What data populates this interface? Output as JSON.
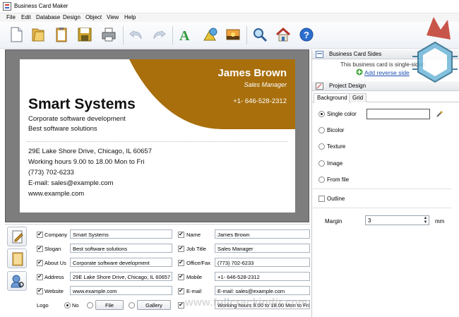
{
  "window": {
    "title": "Business Card Maker"
  },
  "menu": [
    "File",
    "Edit",
    "Database",
    "Design",
    "Object",
    "View",
    "Help"
  ],
  "toolbar": {
    "icons": [
      "new-document-icon",
      "open-folder-icon",
      "clipboard-icon",
      "save-icon",
      "print-icon",
      "undo-icon",
      "redo-icon",
      "text-icon",
      "shapes-icon",
      "image-icon",
      "zoom-icon",
      "home-icon",
      "help-icon"
    ]
  },
  "card": {
    "company": "Smart Systems",
    "slogan_line1": "Corporate software development",
    "slogan_line2": "Best software solutions",
    "name": "James Brown",
    "job_title": "Sales Manager",
    "phone": "+1- 646-528-2312",
    "address": "29E Lake Shore Drive, Chicago, IL 60657",
    "hours": "Working hours 9.00 to 18.00 Mon to Fri",
    "office_fax": "(773) 702-6233",
    "email": "E-mail: sales@example.com",
    "website": "www.example.com",
    "accent_color": "#A86F0C"
  },
  "panel": {
    "sides_header": "Business Card Sides",
    "sides_note": "This business card is single-sided.",
    "add_reverse": "Add reverse side",
    "project_header": "Project Design",
    "tabs": [
      "Background",
      "Grid"
    ],
    "bg_options": [
      "Single color",
      "Bicolor",
      "Texture",
      "Image",
      "From file"
    ],
    "selected_option": "Single color",
    "outline_label": "Outline",
    "margin_label": "Margin",
    "margin_value": "3",
    "margin_unit": "mm"
  },
  "form": {
    "left": [
      {
        "label": "Company",
        "value": "Smart Systems"
      },
      {
        "label": "Slogan",
        "value": "Best software solutions"
      },
      {
        "label": "About Us",
        "value": "Corporate software development"
      },
      {
        "label": "Address",
        "value": "29E Lake Shore Drive, Chicago, IL 60657"
      },
      {
        "label": "Website",
        "value": "www.example.com"
      }
    ],
    "right": [
      {
        "label": "Name",
        "value": "James Brown"
      },
      {
        "label": "Job Title",
        "value": "Sales Manager"
      },
      {
        "label": "Office/Fax",
        "value": "(773) 702-6233"
      },
      {
        "label": "Mobile",
        "value": "+1- 646-528-2312"
      },
      {
        "label": "E-mail",
        "value": "E-mail: sales@example.com"
      },
      {
        "label": "",
        "value": "Working hours 9.00 to 18.00 Mon to Fri"
      }
    ],
    "logo_label": "Logo",
    "logo_no": "No",
    "file_button": "File",
    "gallery_button": "Gallery"
  },
  "watermark": "www.fullcrackindir.com"
}
